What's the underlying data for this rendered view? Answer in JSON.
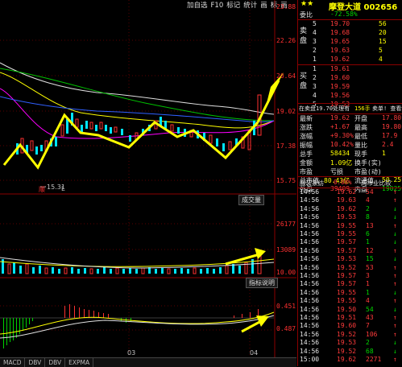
{
  "toolbar": {
    "items": [
      "加自选",
      "F10",
      "标记",
      "统计",
      "画",
      "标",
      "画"
    ]
  },
  "price_axis": [
    "23.88",
    "22.26",
    "20.64",
    "19.02",
    "17.38",
    "15.75"
  ],
  "low_marker": "15.31",
  "vol_axis": [
    "26177",
    "13089",
    "10.00"
  ],
  "macd_axis": [
    "0.451",
    "0.487"
  ],
  "vol_tag": "成交量",
  "indicator_tag": "指标说明",
  "date_labels": [
    "03",
    "04"
  ],
  "tabs": [
    "MACD",
    "DBV",
    "DBV",
    "EXPMA"
  ],
  "small_labels": [
    "顺",
    "L"
  ],
  "quote": {
    "title": "摩登大道 002656",
    "weibi_label": "委比",
    "weibi_value": "-72.58%",
    "weicha_label": "委差",
    "sell_label": "卖盘",
    "buy_label": "买盘",
    "sell": [
      {
        "lvl": "5",
        "price": "19.70",
        "vol": "56"
      },
      {
        "lvl": "4",
        "price": "19.68",
        "vol": "20"
      },
      {
        "lvl": "3",
        "price": "19.65",
        "vol": "15"
      },
      {
        "lvl": "2",
        "price": "19.63",
        "vol": "5"
      },
      {
        "lvl": "1",
        "price": "19.62",
        "vol": "4"
      }
    ],
    "buy": [
      {
        "lvl": "1",
        "price": "19.61",
        "vol": ""
      },
      {
        "lvl": "2",
        "price": "19.60",
        "vol": ""
      },
      {
        "lvl": "3",
        "price": "19.59",
        "vol": ""
      },
      {
        "lvl": "4",
        "price": "19.56",
        "vol": ""
      },
      {
        "lvl": "5",
        "price": "19.53",
        "vol": ""
      }
    ],
    "notice_left": "在卖盘19.70处理有",
    "notice_mid": "156手",
    "notice_right": "卖单! 查看详细",
    "stats_left": [
      {
        "k": "最新",
        "v": "19.62"
      },
      {
        "k": "涨跌",
        "v": "+1.67"
      },
      {
        "k": "涨幅",
        "v": "+9.30%"
      },
      {
        "k": "振幅",
        "v": "10.42%"
      },
      {
        "k": "总手",
        "v": "58434"
      },
      {
        "k": "金额",
        "v": "1.09亿"
      },
      {
        "k": "市盈",
        "v": "亏损"
      },
      {
        "k": "总市值",
        "v": "80.43亿"
      },
      {
        "k": "外盘",
        "v": "39409"
      }
    ],
    "stats_right": [
      {
        "k": "开盘",
        "v": "17.80"
      },
      {
        "k": "最高",
        "v": "19.80"
      },
      {
        "k": "最低",
        "v": "17.9"
      },
      {
        "k": "量比",
        "v": "2.4"
      },
      {
        "k": "现手",
        "v": "1"
      },
      {
        "k": "换手(实)",
        "v": ""
      },
      {
        "k": "市盈(动)",
        "v": ""
      },
      {
        "k": "流通值",
        "v": "50.25"
      },
      {
        "k": "内盘",
        "v": "19025"
      }
    ],
    "tab1": "服装家纺",
    "tab1_val": "0.08%",
    "tab2": "两市业比较",
    "trades": [
      {
        "t": "14:56",
        "p": "19.62",
        "v": "54",
        "d": "B"
      },
      {
        "t": "14:56",
        "p": "19.63",
        "v": "4",
        "d": "B"
      },
      {
        "t": "14:56",
        "p": "19.62",
        "v": "2",
        "d": "S"
      },
      {
        "t": "14:56",
        "p": "19.53",
        "v": "8",
        "d": "S"
      },
      {
        "t": "14:56",
        "p": "19.55",
        "v": "13",
        "d": "B"
      },
      {
        "t": "14:56",
        "p": "19.55",
        "v": "6",
        "d": "S"
      },
      {
        "t": "14:56",
        "p": "19.57",
        "v": "1",
        "d": "S"
      },
      {
        "t": "14:56",
        "p": "19.57",
        "v": "12",
        "d": "B"
      },
      {
        "t": "14:56",
        "p": "19.53",
        "v": "15",
        "d": "S"
      },
      {
        "t": "14:56",
        "p": "19.52",
        "v": "53",
        "d": "B"
      },
      {
        "t": "14:56",
        "p": "19.57",
        "v": "3",
        "d": "B"
      },
      {
        "t": "14:56",
        "p": "19.57",
        "v": "1",
        "d": "B"
      },
      {
        "t": "14:56",
        "p": "19.55",
        "v": "1",
        "d": "S"
      },
      {
        "t": "14:56",
        "p": "19.55",
        "v": "4",
        "d": "B"
      },
      {
        "t": "14:56",
        "p": "19.50",
        "v": "54",
        "d": "S"
      },
      {
        "t": "14:56",
        "p": "19.51",
        "v": "43",
        "d": "B"
      },
      {
        "t": "14:56",
        "p": "19.60",
        "v": "7",
        "d": "B"
      },
      {
        "t": "14:56",
        "p": "19.52",
        "v": "106",
        "d": "B"
      },
      {
        "t": "14:56",
        "p": "19.53",
        "v": "2",
        "d": "S"
      },
      {
        "t": "14:56",
        "p": "19.52",
        "v": "68",
        "d": "S"
      },
      {
        "t": "15:00",
        "p": "19.62",
        "v": "2271",
        "d": "B"
      }
    ]
  }
}
